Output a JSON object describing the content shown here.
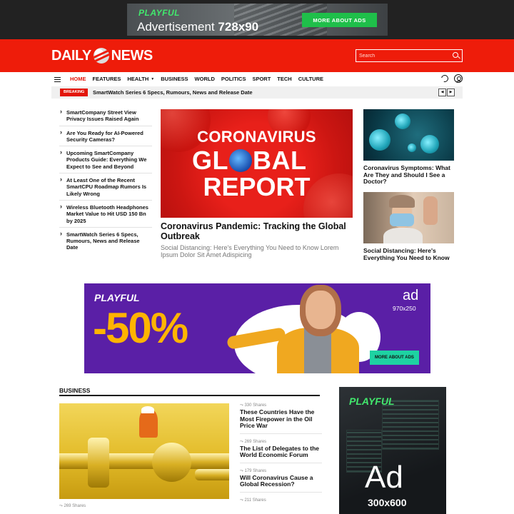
{
  "top_ad": {
    "brand": "PLAYFUL",
    "text": "Advertisement",
    "size": "728x90",
    "button": "MORE ABOUT ADS"
  },
  "header": {
    "logo_left": "DAILY",
    "logo_right": "NEWS",
    "search_placeholder": "Search",
    "bg_color": "#ee1c0a"
  },
  "nav": {
    "items": [
      "HOME",
      "FEATURES",
      "HEALTH",
      "BUSINESS",
      "WORLD",
      "POLITICS",
      "SPORT",
      "TECH",
      "CULTURE"
    ],
    "active": "HOME",
    "accent": "#e3160a"
  },
  "breaking": {
    "label": "BREAKING",
    "headline": "SmartWatch Series 6 Specs, Rumours, News and Release Date",
    "prev": "◀",
    "next": "▶"
  },
  "left_list": [
    "SmartCompany Street View Privacy Issues Raised Again",
    "Are You Ready for AI-Powered Security Cameras?",
    "Upcoming SmartCompany Products Guide: Everything We Expect to See and Beyond",
    "At Least One of the Recent SmartCPU Roadmap Rumors Is Likely Wrong",
    "Wireless Bluetooth Headphones Market Value to Hit USD 150 Bn by 2025",
    "SmartWatch Series 6 Specs, Rumours, News and Release Date"
  ],
  "feature": {
    "image_line1": "CORONAVIRUS",
    "image_line2_a": "GL",
    "image_line2_b": "BAL",
    "image_line3": "REPORT",
    "title": "Coronavirus Pandemic: Tracking the Global Outbreak",
    "excerpt": "Social Distancing: Here's Everything You Need to Know Lorem Ipsum Dolor Sit Amet Adispicing"
  },
  "side_posts": [
    "Coronavirus Symptoms: What Are They and Should I See a Doctor?",
    "Social Distancing: Here's Everything You Need to Know"
  ],
  "mid_ad": {
    "brand": "PLAYFUL",
    "discount": "-50%",
    "label": "ad",
    "size": "970x250",
    "button": "MORE ABOUT ADS"
  },
  "business": {
    "section_title": "BUSINESS",
    "main_shares": "269 Shares",
    "posts": [
      {
        "shares": "330 Shares",
        "title": "These Countries Have the Most Firepower in the Oil Price War"
      },
      {
        "shares": "269 Shares",
        "title": "The List of Delegates to the World Economic Forum"
      },
      {
        "shares": "179 Shares",
        "title": "Will Coronavirus Cause a Global Recession?"
      },
      {
        "shares": "211 Shares",
        "title": ""
      }
    ]
  },
  "side_ad": {
    "brand": "PLAYFUL",
    "label": "Ad",
    "size": "300x600"
  }
}
